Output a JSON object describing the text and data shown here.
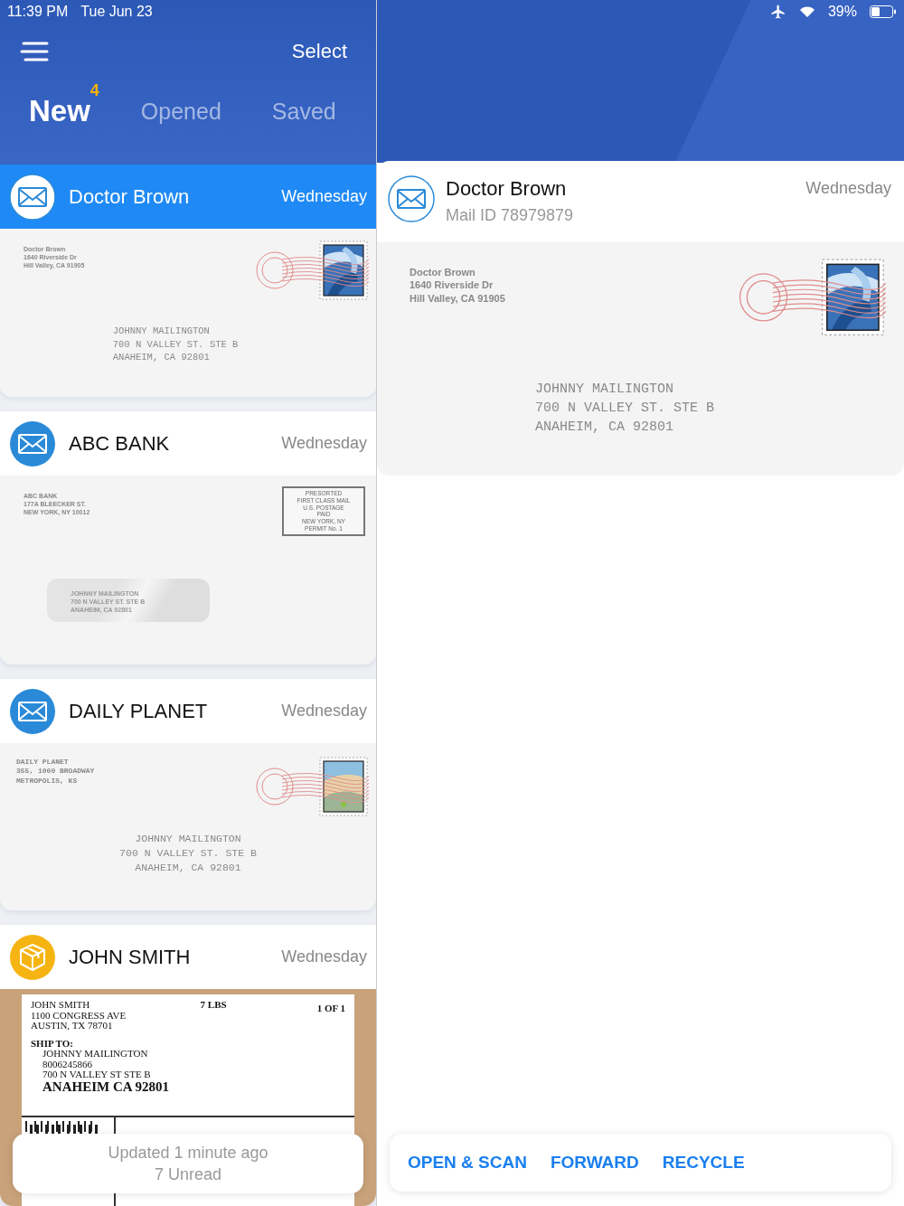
{
  "status_bar": {
    "time": "11:39 PM",
    "date": "Tue Jun 23",
    "battery": "39%"
  },
  "header": {
    "select": "Select",
    "tabs": [
      {
        "label": "New",
        "badge": "4",
        "selected": true
      },
      {
        "label": "Opened",
        "selected": false
      },
      {
        "label": "Saved",
        "selected": false
      }
    ]
  },
  "mail_items": [
    {
      "sender": "Doctor Brown",
      "date": "Wednesday",
      "selected": true,
      "kind": "letter",
      "scan": {
        "kind": "stamped",
        "stamp": {
          "kind": "waves"
        },
        "return_address": {
          "kind": "printed",
          "lines": [
            "Doctor Brown",
            "1640 Riverside Dr",
            "Hill Valley, CA 91905"
          ]
        },
        "recipient": {
          "kind": "indented",
          "lines": [
            "JOHNNY MAILINGTON",
            "700 N VALLEY ST. STE B",
            "ANAHEIM, CA 92801"
          ]
        }
      }
    },
    {
      "sender": "ABC BANK",
      "date": "Wednesday",
      "selected": false,
      "kind": "letter",
      "scan": {
        "kind": "window",
        "return_address": [
          "ABC BANK",
          "177A BLEECKER ST.",
          "NEW YORK, NY 10012"
        ],
        "indicia": [
          "PRESORTED",
          "FIRST CLASS MAIL",
          "U.S. POSTAGE",
          "PAID",
          "NEW YORK, NY",
          "PERMIT No. 1"
        ],
        "recipient": [
          "JOHNNY MAILINGTON",
          "700 N VALLEY ST. STE B",
          "ANAHEIM, CA 92801"
        ]
      }
    },
    {
      "sender": "DAILY PLANET",
      "date": "Wednesday",
      "selected": false,
      "kind": "letter",
      "scan": {
        "kind": "stamped",
        "stamp": {
          "kind": "landscape"
        },
        "return_address": {
          "kind": "typed",
          "lines": [
            "DAILY PLANET",
            "355, 1000 BROADWAY",
            "METROPOLIS, KS"
          ]
        },
        "recipient": {
          "kind": "centered",
          "lines": [
            "JOHNNY MAILINGTON",
            "700 N VALLEY ST. STE B",
            "ANAHEIM, CA 92801"
          ]
        }
      }
    },
    {
      "sender": "JOHN SMITH",
      "date": "Wednesday",
      "selected": false,
      "kind": "package",
      "scan": {
        "kind": "label",
        "sender": [
          "JOHN SMITH",
          "1100 CONGRESS AVE",
          "AUSTIN, TX 78701"
        ],
        "weight": "7 LBS",
        "count": "1 OF 1",
        "ship_to": "SHIP TO:",
        "recipient": [
          "JOHNNY MAILINGTON",
          "8006245866",
          "700 N VALLEY ST STE B"
        ],
        "city": "ANAHEIM CA 92801"
      }
    }
  ],
  "toast": {
    "updated": "Updated 1 minute ago",
    "unread": "7 Unread"
  },
  "detail": {
    "sender": "Doctor Brown",
    "mail_id": "Mail ID 78979879",
    "date": "Wednesday",
    "kind": "letter",
    "scan": {
      "kind": "stamped",
      "stamp": {
        "kind": "waves"
      },
      "return_address": {
        "kind": "printed",
        "lines": [
          "Doctor Brown",
          "1640 Riverside Dr",
          "Hill Valley, CA 91905"
        ]
      },
      "recipient": {
        "kind": "indented",
        "lines": [
          "JOHNNY MAILINGTON",
          "700 N VALLEY ST. STE B",
          "ANAHEIM, CA 92801"
        ]
      }
    }
  },
  "actions": [
    "OPEN & SCAN",
    "FORWARD",
    "RECYCLE"
  ]
}
